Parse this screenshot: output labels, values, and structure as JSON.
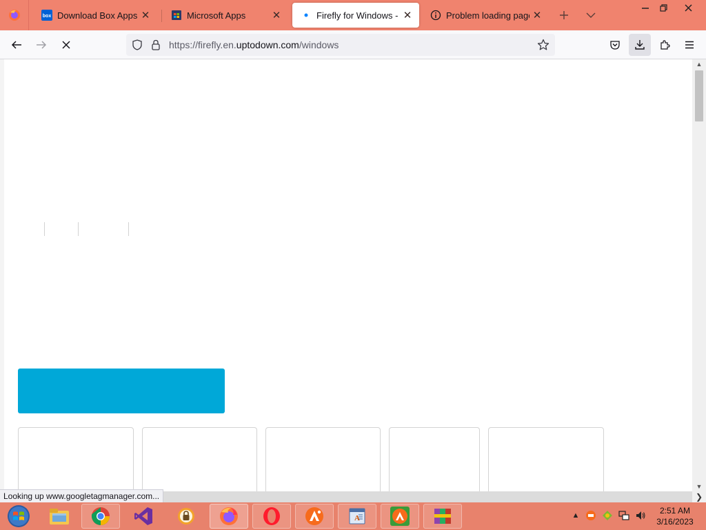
{
  "browser": {
    "tabs": [
      {
        "title": "Download Box Apps On",
        "favicon": "box-icon",
        "active": false
      },
      {
        "title": "Microsoft Apps",
        "favicon": "microsoft-store-icon",
        "active": false
      },
      {
        "title": "Firefly for Windows - Do",
        "favicon": "loading-dot-icon",
        "active": true
      },
      {
        "title": "Problem loading page",
        "favicon": "info-icon",
        "active": false
      }
    ],
    "url_prefix": "https://firefly.en.",
    "url_domain": "uptodown.com",
    "url_path": "/windows",
    "status_text": "Looking up www.googletagmanager.com..."
  },
  "page": {
    "cta_color": "#00a8d8"
  },
  "taskbar": {
    "apps": [
      "file-explorer-icon",
      "chrome-icon",
      "visual-studio-icon",
      "vpn-lock-icon",
      "firefox-icon",
      "opera-icon",
      "avast-icon",
      "wordpad-icon",
      "avast-secureline-icon",
      "winrar-icon"
    ],
    "clock_time": "2:51 AM",
    "clock_date": "3/16/2023"
  },
  "colors": {
    "tabstrip": "#f0836e",
    "taskbar": "#e8826c"
  }
}
